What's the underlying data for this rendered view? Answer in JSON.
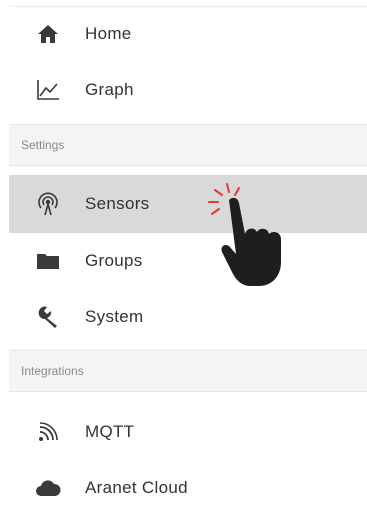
{
  "nav": {
    "home": {
      "label": "Home",
      "icon": "home-icon"
    },
    "graph": {
      "label": "Graph",
      "icon": "graph-icon"
    },
    "settings_header": "Settings",
    "sensors": {
      "label": "Sensors",
      "icon": "sensors-icon",
      "active": true
    },
    "groups": {
      "label": "Groups",
      "icon": "folder-icon"
    },
    "system": {
      "label": "System",
      "icon": "wrench-icon"
    },
    "integrations_header": "Integrations",
    "mqtt": {
      "label": "MQTT",
      "icon": "rss-icon"
    },
    "cloud": {
      "label": "Aranet Cloud",
      "icon": "cloud-icon"
    }
  },
  "colors": {
    "active_bg": "#d9d9d9",
    "icon": "#3a3a3a",
    "click_burst": "#e23a3a"
  }
}
